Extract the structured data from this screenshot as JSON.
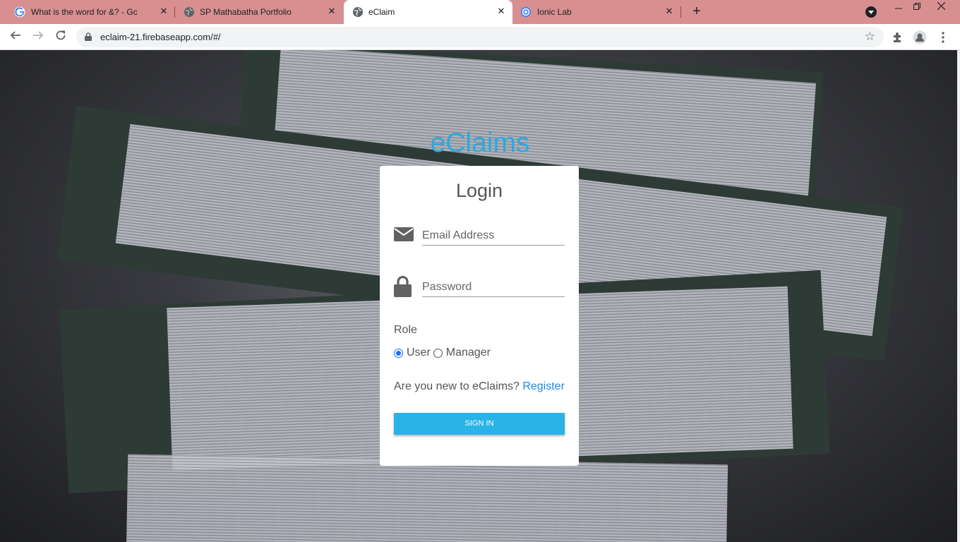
{
  "browser": {
    "tabs": [
      {
        "title": "What is the word for &? - Google",
        "favicon": "google-icon",
        "active": false
      },
      {
        "title": "SP Mathabatha Portfolio",
        "favicon": "globe-icon",
        "active": false
      },
      {
        "title": "eClaim",
        "favicon": "globe-icon",
        "active": true
      },
      {
        "title": "Ionic Lab",
        "favicon": "ionic-icon",
        "active": false
      }
    ],
    "close_glyph": "✕",
    "new_tab_glyph": "+",
    "url": "eclaim-21.firebaseapp.com/#/",
    "tabstrip_color": "#d88f90"
  },
  "page": {
    "brand": "eClaims",
    "login": {
      "heading": "Login",
      "email_placeholder": "Email Address",
      "email_value": "",
      "password_placeholder": "Password",
      "password_value": "",
      "role_label": "Role",
      "roles": [
        {
          "label": "User",
          "checked": true
        },
        {
          "label": "Manager",
          "checked": false
        }
      ],
      "register_prompt": "Are you new to eClaims?",
      "register_link": "Register",
      "signin_label": "SIGN IN"
    },
    "accent_color": "#2ea8e0",
    "button_color": "#2ab3e6"
  }
}
